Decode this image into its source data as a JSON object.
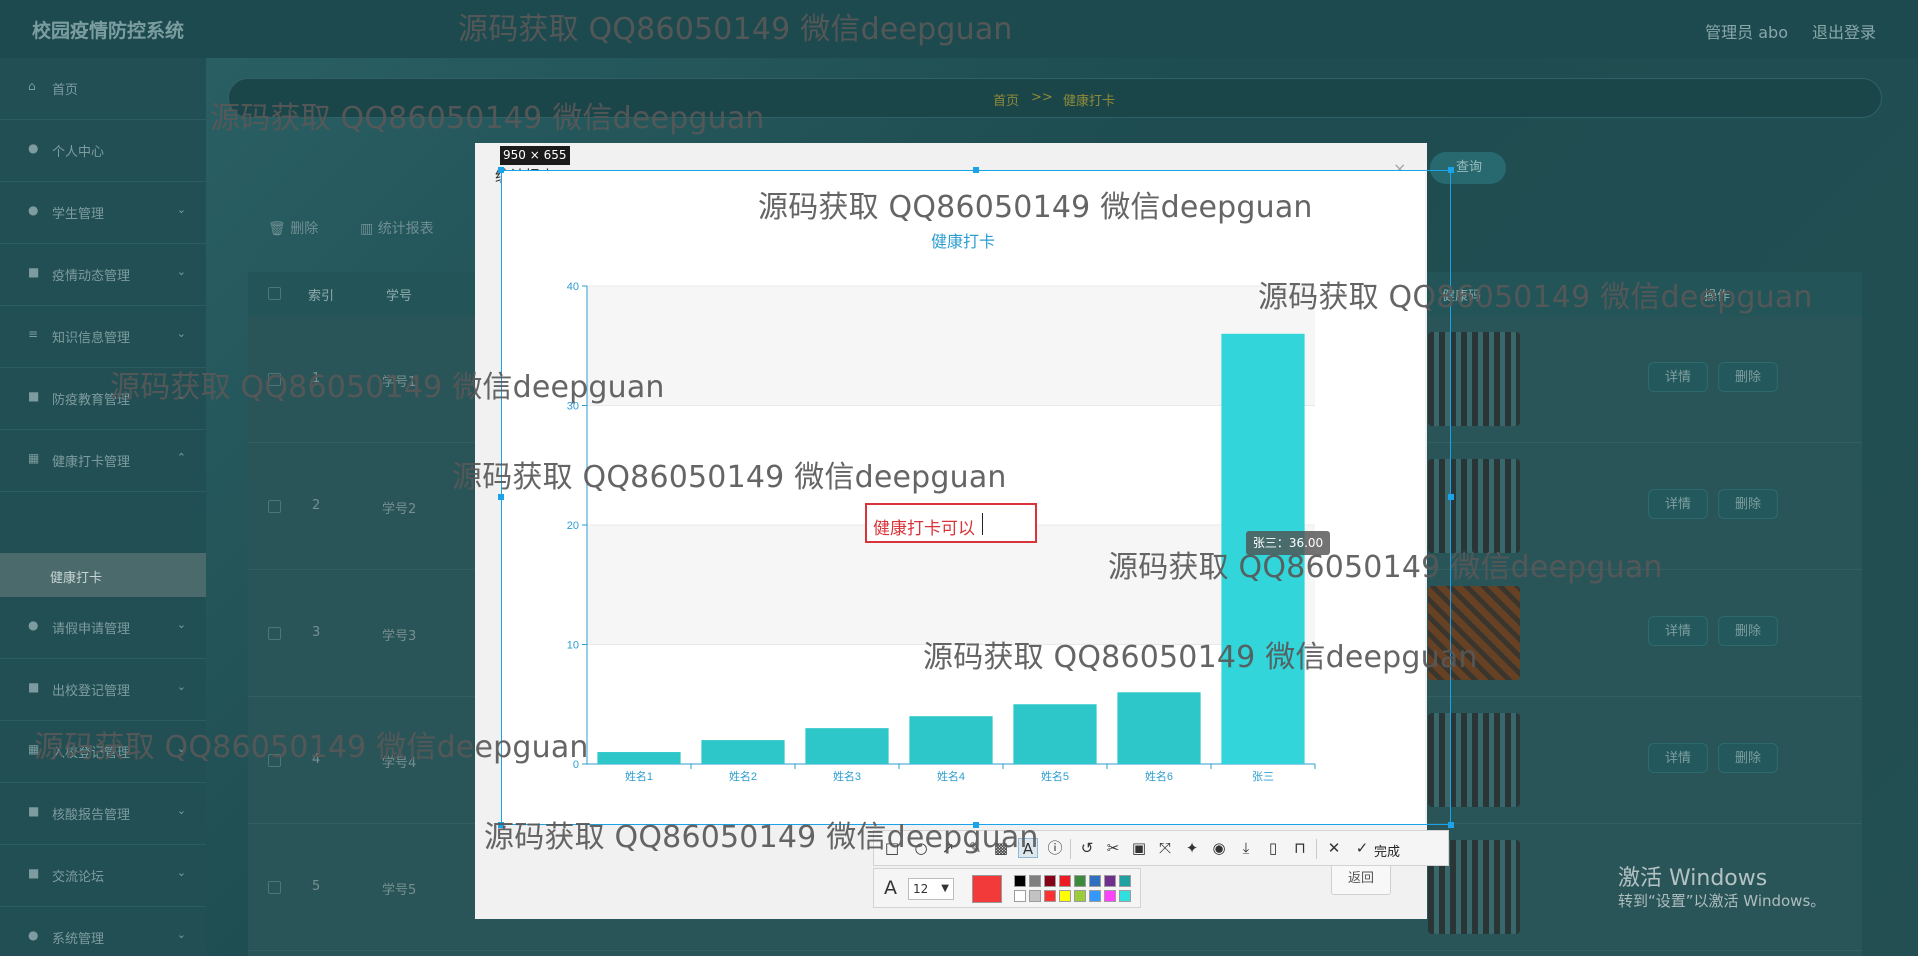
{
  "app": {
    "title": "校园疫情防控系统",
    "user_label": "管理员 abo",
    "logout": "退出登录"
  },
  "sidebar": {
    "items": [
      {
        "label": "首页",
        "icon": "home-icon"
      },
      {
        "label": "个人中心",
        "icon": "user-icon"
      },
      {
        "label": "学生管理",
        "icon": "users-icon"
      },
      {
        "label": "疫情动态管理",
        "icon": "news-icon"
      },
      {
        "label": "知识信息管理",
        "icon": "list-icon"
      },
      {
        "label": "防疫教育管理",
        "icon": "book-icon"
      },
      {
        "label": "健康打卡管理",
        "icon": "grid-icon"
      },
      {
        "label": "请假申请管理",
        "icon": "user-icon"
      },
      {
        "label": "出校登记管理",
        "icon": "news-icon"
      },
      {
        "label": "入校登记管理",
        "icon": "grid-icon"
      },
      {
        "label": "核酸报告管理",
        "icon": "file-icon"
      },
      {
        "label": "交流论坛",
        "icon": "chat-icon"
      },
      {
        "label": "系统管理",
        "icon": "pin-icon"
      }
    ],
    "active_sub": "健康打卡"
  },
  "breadcrumb": {
    "home": "首页",
    "sep": ">>",
    "current": "健康打卡"
  },
  "search_button": "查询",
  "toolbar": {
    "delete": "删除",
    "stats": "统计报表"
  },
  "table": {
    "headers": [
      "索引",
      "学号",
      "健康码",
      "操作"
    ],
    "rows": [
      {
        "index": "1",
        "sno": "学号1"
      },
      {
        "index": "2",
        "sno": "学号2"
      },
      {
        "index": "3",
        "sno": "学号3"
      },
      {
        "index": "4",
        "sno": "学号4"
      },
      {
        "index": "5",
        "sno": "学号5"
      }
    ],
    "detail_btn": "详情",
    "delete_btn": "删除"
  },
  "modal": {
    "title": "统计报表",
    "back_button": "返回"
  },
  "chart_data": {
    "type": "bar",
    "title": "健康打卡",
    "categories": [
      "姓名1",
      "姓名2",
      "姓名3",
      "姓名4",
      "姓名5",
      "姓名6",
      "张三"
    ],
    "values": [
      1,
      2,
      3,
      4,
      5,
      6,
      36
    ],
    "ylim": [
      0,
      40
    ],
    "yticks": [
      0,
      10,
      20,
      30,
      40
    ],
    "grid": true,
    "bar_color": "#2ec7c9",
    "highlight_color": "#31d5da",
    "axis_color": "#2e9ed0"
  },
  "chart_tooltip": "张三：36.00",
  "capture": {
    "size_label": "950 × 655",
    "annotation_text": "健康打卡可以",
    "done_label": "完成",
    "font_size": "12",
    "current_color": "#f23a3a",
    "palette_row1": [
      "#000000",
      "#7f7f7f",
      "#880015",
      "#ed1c24",
      "#3c8a3c",
      "#2f6fbf",
      "#6f2f8f",
      "#20a0a0"
    ],
    "palette_row2": [
      "#ffffff",
      "#c3c3c3",
      "#ff3030",
      "#ffff00",
      "#9bcc3a",
      "#3399ff",
      "#ff40ff",
      "#30dede"
    ]
  },
  "watermark": "源码获取 QQ86050149 微信deepguan",
  "windows": {
    "activate_title": "激活 Windows",
    "activate_hint": "转到“设置”以激活 Windows。"
  }
}
